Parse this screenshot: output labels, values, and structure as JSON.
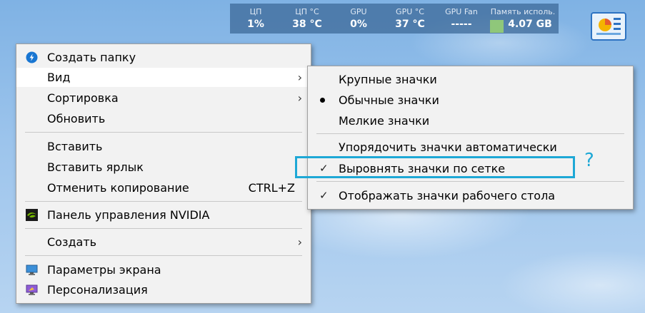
{
  "hwmon": {
    "columns": [
      {
        "label": "ЦП",
        "value": "1%"
      },
      {
        "label": "ЦП °C",
        "value": "38 °C"
      },
      {
        "label": "GPU",
        "value": "0%"
      },
      {
        "label": "GPU °C",
        "value": "37 °C"
      },
      {
        "label": "GPU Fan",
        "value": "-----"
      },
      {
        "label": "Память исполь.",
        "value": "4.07 GB"
      }
    ],
    "accent_color": "#8fc77a"
  },
  "desktop_icon": {
    "icon": "control-panel-icon"
  },
  "context_menu": {
    "items": [
      {
        "label": "Создать папку",
        "icon": "folder-icon"
      },
      {
        "label": "Вид",
        "submenu": true
      },
      {
        "label": "Сортировка",
        "submenu": true
      },
      {
        "label": "Обновить"
      },
      {
        "label": "Вставить"
      },
      {
        "label": "Вставить ярлык"
      },
      {
        "label": "Отменить копирование",
        "shortcut": "CTRL+Z"
      },
      {
        "label": "Панель управления NVIDIA",
        "icon": "nvidia-icon"
      },
      {
        "label": "Создать",
        "submenu": true
      },
      {
        "label": "Параметры экрана",
        "icon": "display-icon"
      },
      {
        "label": "Персонализация",
        "icon": "personalize-icon"
      }
    ]
  },
  "view_submenu": {
    "items": [
      {
        "label": "Крупные значки"
      },
      {
        "label": "Обычные значки",
        "selected": true
      },
      {
        "label": "Мелкие значки"
      },
      {
        "label": "Упорядочить значки автоматически"
      },
      {
        "label": "Выровнять значки по сетке",
        "checked": true
      },
      {
        "label": "Отображать значки рабочего стола",
        "checked": true
      }
    ]
  },
  "annotation": {
    "mark": "?",
    "color": "#1ea8d6"
  }
}
